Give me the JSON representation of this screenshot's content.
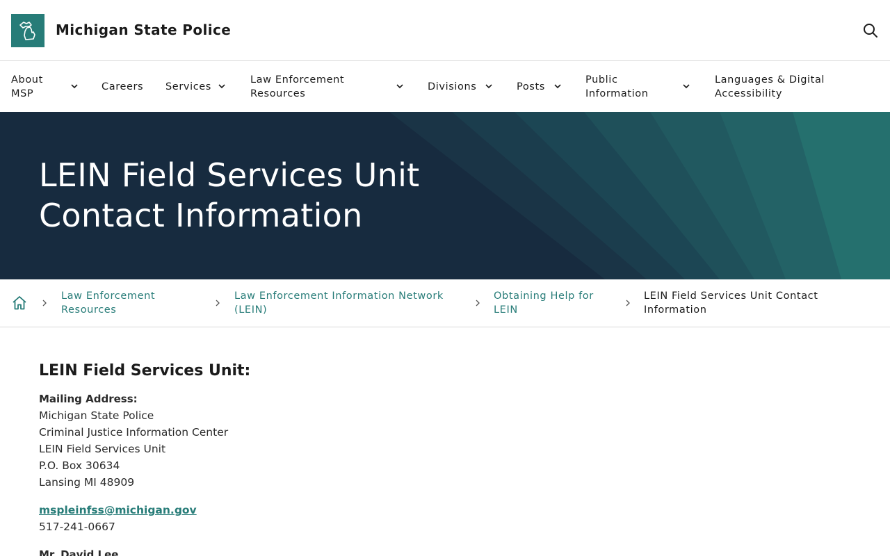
{
  "header": {
    "site_title": "Michigan State Police",
    "logo_icon": "michigan-map-icon",
    "search_icon": "search-icon"
  },
  "nav": {
    "items": [
      {
        "label": "About MSP",
        "has_dropdown": true
      },
      {
        "label": "Careers",
        "has_dropdown": false
      },
      {
        "label": "Services",
        "has_dropdown": true
      },
      {
        "label": "Law Enforcement Resources",
        "has_dropdown": true
      },
      {
        "label": "Divisions",
        "has_dropdown": true
      },
      {
        "label": "Posts",
        "has_dropdown": true
      },
      {
        "label": "Public Information",
        "has_dropdown": true
      },
      {
        "label": "Languages & Digital Accessibility",
        "has_dropdown": false
      }
    ]
  },
  "hero": {
    "title": "LEIN Field Services Unit Contact Information"
  },
  "breadcrumb": {
    "home_icon": "home-icon",
    "items": [
      {
        "label": "Law Enforcement Resources",
        "link": true
      },
      {
        "label": "Law Enforcement Information Network (LEIN)",
        "link": true
      },
      {
        "label": "Obtaining Help for LEIN",
        "link": true
      },
      {
        "label": "LEIN Field Services Unit Contact Information",
        "link": false
      }
    ]
  },
  "content": {
    "heading": "LEIN Field Services Unit:",
    "mailing_label": "Mailing Address:",
    "address_lines": [
      "Michigan State Police",
      "Criminal Justice Information Center",
      "LEIN Field Services Unit",
      "P.O. Box 30634",
      "Lansing MI 48909"
    ],
    "email": "mspleinfss@michigan.gov",
    "phone": "517-241-0667",
    "next_contact_name": "Mr. David Lee"
  },
  "colors": {
    "accent": "#277c78",
    "hero_bg": "#172b3f",
    "text": "#1b1b1b"
  }
}
